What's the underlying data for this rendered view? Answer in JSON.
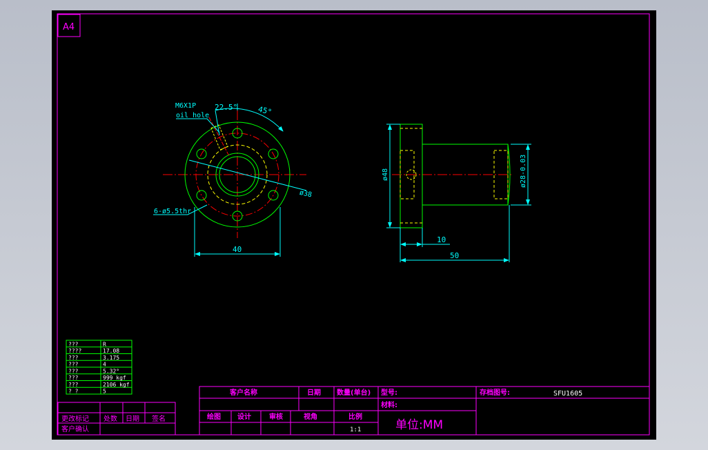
{
  "colors": {
    "background": "#000000",
    "border": "#ff00ff",
    "outline": "#00ff00",
    "centerline": "#ff0000",
    "hidden": "#ffff00",
    "dimension": "#00ffff",
    "text": "#ff00ff",
    "table_text": "#ffffff"
  },
  "sheet": {
    "size_label": "A4"
  },
  "front_view": {
    "callout_thread": "M6X1P",
    "callout_hole": "oil hole",
    "angle_small": "22.5°",
    "angle_large": "45°",
    "bolt_holes": "6-ø5.5thr",
    "bolt_circle_dia": "ø38",
    "width": "40"
  },
  "side_view": {
    "flange_dia": "ø48",
    "body_dia": "ø28-0.03",
    "flange_thickness": "10",
    "length": "50"
  },
  "spec_table": {
    "rows": [
      {
        "k": "??? ",
        "v": "R"
      },
      {
        "k": "????",
        "v": "17.08"
      },
      {
        "k": "???",
        "v": "3.175"
      },
      {
        "k": "???",
        "v": "4"
      },
      {
        "k": "???",
        "v": "5.32°"
      },
      {
        "k": "???",
        "v": "999 kgf"
      },
      {
        "k": "???",
        "v": "2106 kgf"
      },
      {
        "k": "?  ?",
        "v": "5"
      }
    ]
  },
  "revision_block": {
    "change_mark": "更改标记",
    "count": "处数",
    "date": "日期",
    "signature": "签名",
    "customer_confirm": "客户确认"
  },
  "title_block": {
    "customer_name": "客户名称",
    "date": "日期",
    "quantity": "数量(单台)",
    "model": "型号:",
    "drawing_no_label": "存档图号:",
    "drawing_no": "SFU1605",
    "material": "材料:",
    "drafted": "绘图",
    "design": "设计",
    "review": "审核",
    "projection": "视角",
    "scale_label": "比例",
    "scale": "1:1",
    "unit": "单位:MM"
  }
}
